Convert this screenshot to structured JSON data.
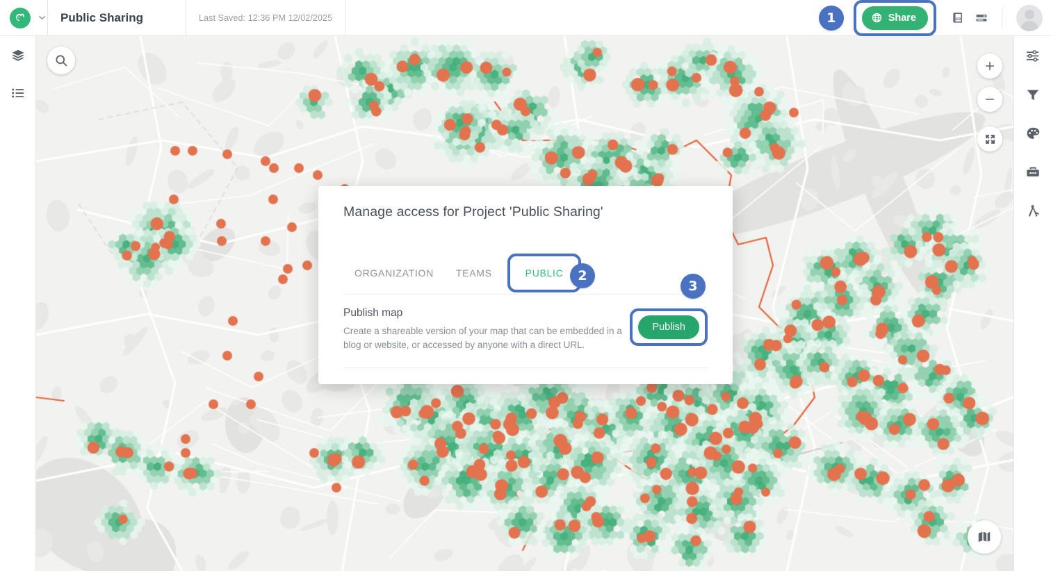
{
  "app": {
    "logo_icon": "goat-logo-icon",
    "brand_green": "#34b87a",
    "accent_blue": "#4a72c0"
  },
  "topbar": {
    "project_title": "Public Sharing",
    "last_saved": "Last Saved: 12:36 PM 12/02/2025",
    "share_label": "Share",
    "share_icon": "globe-icon",
    "chevron_icon": "chevron-down-icon",
    "legend_icon": "legend-book-icon",
    "table_icon": "data-table-icon",
    "avatar_icon": "user-avatar",
    "badge_1": "1"
  },
  "left_rail": {
    "items": [
      {
        "icon": "layers-icon",
        "name": "sidebar-item-layers"
      },
      {
        "icon": "list-icon",
        "name": "sidebar-item-list"
      }
    ]
  },
  "right_rail": {
    "items": [
      {
        "icon": "sliders-icon",
        "name": "sidebar-item-settings"
      },
      {
        "icon": "filter-icon",
        "name": "sidebar-item-filter"
      },
      {
        "icon": "palette-icon",
        "name": "sidebar-item-style"
      },
      {
        "icon": "toolbox-icon",
        "name": "sidebar-item-tools"
      },
      {
        "icon": "compass-icon",
        "name": "sidebar-item-measure"
      }
    ]
  },
  "map": {
    "search_icon": "search-icon",
    "zoom_in_label": "+",
    "zoom_out_label": "−",
    "expand_icon": "fullscreen-icon",
    "basemap_icon": "map-fold-icon",
    "background_color": "#f2f2f0",
    "hex_color": "#5cb98b",
    "point_color": "#e3734f",
    "boundary_color": "#e2663a"
  },
  "dialog": {
    "title": "Manage access for Project 'Public Sharing'",
    "tabs": [
      {
        "label": "ORGANIZATION",
        "active": false
      },
      {
        "label": "TEAMS",
        "active": false
      },
      {
        "label": "PUBLIC",
        "active": true
      }
    ],
    "badge_2": "2",
    "badge_3": "3",
    "section": {
      "title": "Publish map",
      "description": "Create a shareable version of your map that can be embedded in a blog or website, or accessed by anyone with a direct URL.",
      "button_label": "Publish"
    }
  }
}
